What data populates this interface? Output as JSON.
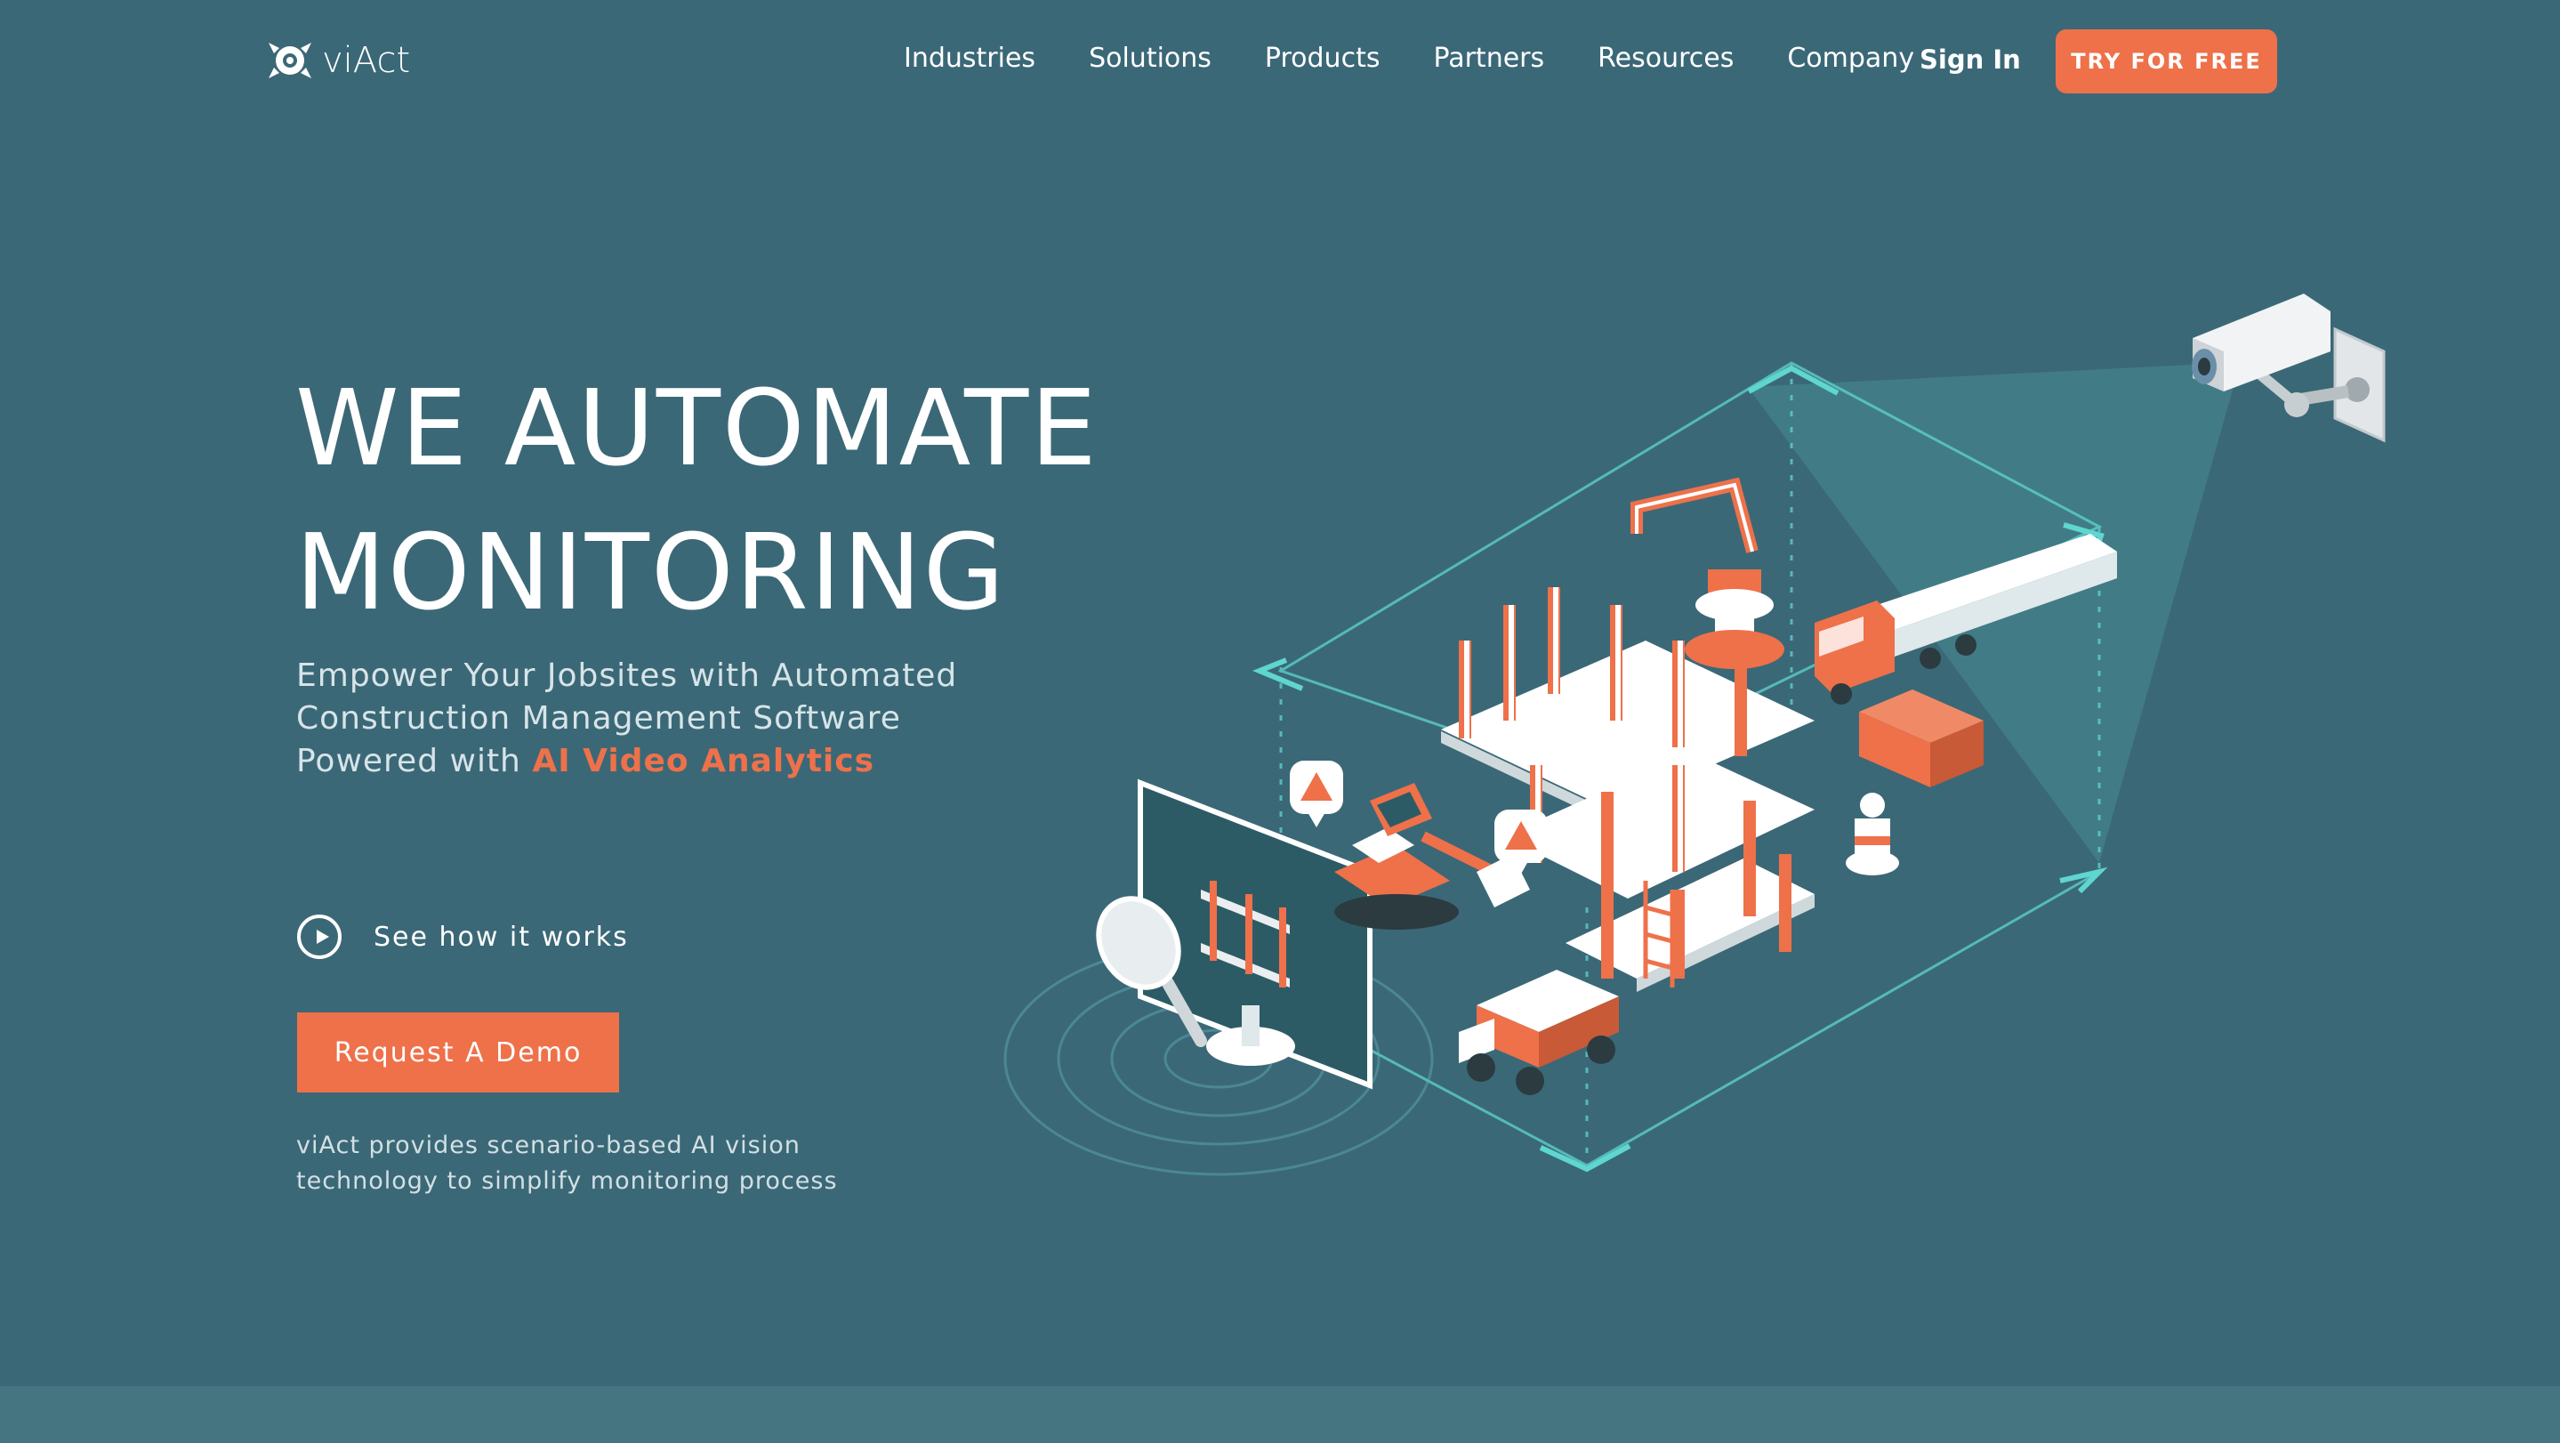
{
  "header": {
    "logo_text": "viAct",
    "nav": [
      "Industries",
      "Solutions",
      "Products",
      "Partners",
      "Resources",
      "Company"
    ],
    "sign_in": "Sign In",
    "try_button": "TRY FOR FREE"
  },
  "hero": {
    "headline_line1": "WE AUTOMATE",
    "headline_line2": "MONITORING",
    "subtext_main": "Empower Your Jobsites with Automated Construction Management Software Powered with",
    "subtext_highlight": "AI Video Analytics",
    "how_it_works": "See how it works",
    "demo_button": "Request A Demo",
    "footnote": "viAct provides scenario-based AI vision technology to simplify monitoring process"
  },
  "colors": {
    "background": "#3b6877",
    "accent": "#ee714a",
    "cyan": "#5fd6cf"
  }
}
